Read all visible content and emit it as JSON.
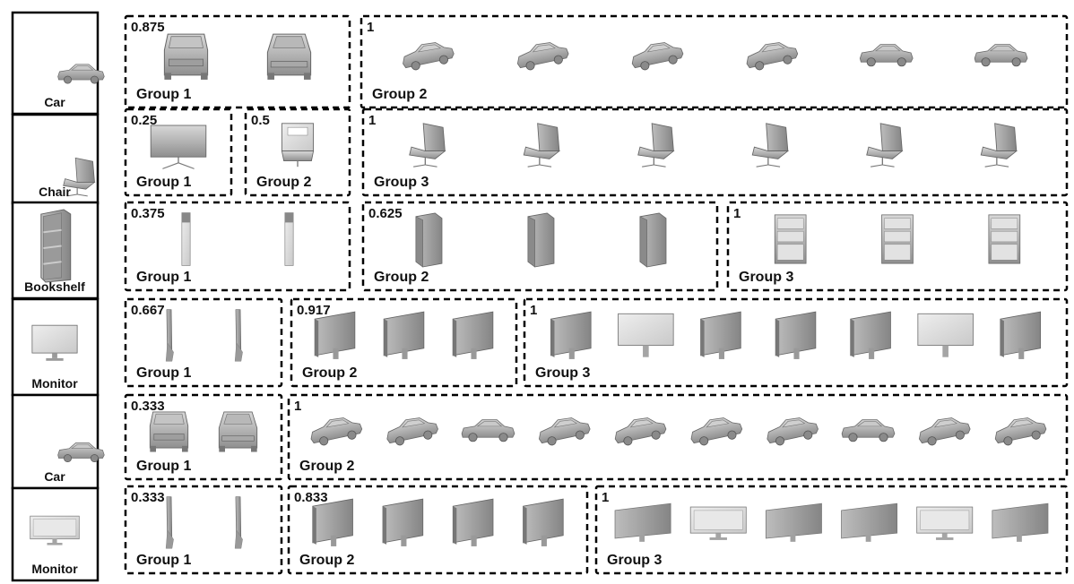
{
  "rows": [
    {
      "category": "Car",
      "thumb": "car-sedan",
      "groups": [
        {
          "score": "0.875",
          "label": "Group 1",
          "views": [
            "car-front",
            "car-back"
          ]
        },
        {
          "score": "1",
          "label": "Group 2",
          "views": [
            "car-side-angle",
            "car-side-angle",
            "car-side-angle",
            "car-side-angle",
            "car-side",
            "car-side"
          ]
        }
      ]
    },
    {
      "category": "Chair",
      "thumb": "chair",
      "groups": [
        {
          "score": "0.25",
          "label": "Group 1",
          "views": [
            "chair-back"
          ]
        },
        {
          "score": "0.5",
          "label": "Group 2",
          "views": [
            "chair-front"
          ]
        },
        {
          "score": "1",
          "label": "Group 3",
          "views": [
            "chair-angle",
            "chair-angle",
            "chair-angle",
            "chair-angle",
            "chair-angle",
            "chair-angle"
          ]
        }
      ]
    },
    {
      "category": "Bookshelf",
      "thumb": "bookshelf",
      "groups": [
        {
          "score": "0.375",
          "label": "Group 1",
          "views": [
            "shelf-edge",
            "shelf-edge"
          ]
        },
        {
          "score": "0.625",
          "label": "Group 2",
          "views": [
            "shelf-back",
            "shelf-back",
            "shelf-back"
          ]
        },
        {
          "score": "1",
          "label": "Group 3",
          "views": [
            "shelf-front",
            "shelf-front",
            "shelf-front"
          ]
        }
      ]
    },
    {
      "category": "Monitor",
      "thumb": "monitor",
      "groups": [
        {
          "score": "0.667",
          "label": "Group 1",
          "views": [
            "monitor-edge",
            "monitor-edge"
          ]
        },
        {
          "score": "0.917",
          "label": "Group 2",
          "views": [
            "monitor-angle",
            "monitor-angle",
            "monitor-angle"
          ]
        },
        {
          "score": "1",
          "label": "Group 3",
          "views": [
            "monitor-angle",
            "monitor-front",
            "monitor-angle",
            "monitor-angle",
            "monitor-angle",
            "monitor-front",
            "monitor-angle"
          ]
        }
      ]
    },
    {
      "category": "Car",
      "thumb": "car-sport",
      "groups": [
        {
          "score": "0.333",
          "label": "Group 1",
          "views": [
            "car-front",
            "car-back"
          ]
        },
        {
          "score": "1",
          "label": "Group 2",
          "views": [
            "car-side-angle",
            "car-side-angle",
            "car-side",
            "car-side-angle",
            "car-side-angle",
            "car-side-angle",
            "car-side-angle",
            "car-side",
            "car-side-angle",
            "car-side-angle"
          ]
        }
      ]
    },
    {
      "category": "Monitor",
      "thumb": "monitor-wide",
      "groups": [
        {
          "score": "0.333",
          "label": "Group 1",
          "views": [
            "monitor-edge",
            "monitor-edge"
          ]
        },
        {
          "score": "0.833",
          "label": "Group 2",
          "views": [
            "monitor-angle",
            "monitor-angle",
            "monitor-angle",
            "monitor-angle"
          ]
        },
        {
          "score": "1",
          "label": "Group 3",
          "views": [
            "monitor-wide-angle",
            "monitor-wide",
            "monitor-wide-angle",
            "monitor-wide-angle",
            "monitor-wide",
            "monitor-wide-angle"
          ]
        }
      ]
    }
  ]
}
